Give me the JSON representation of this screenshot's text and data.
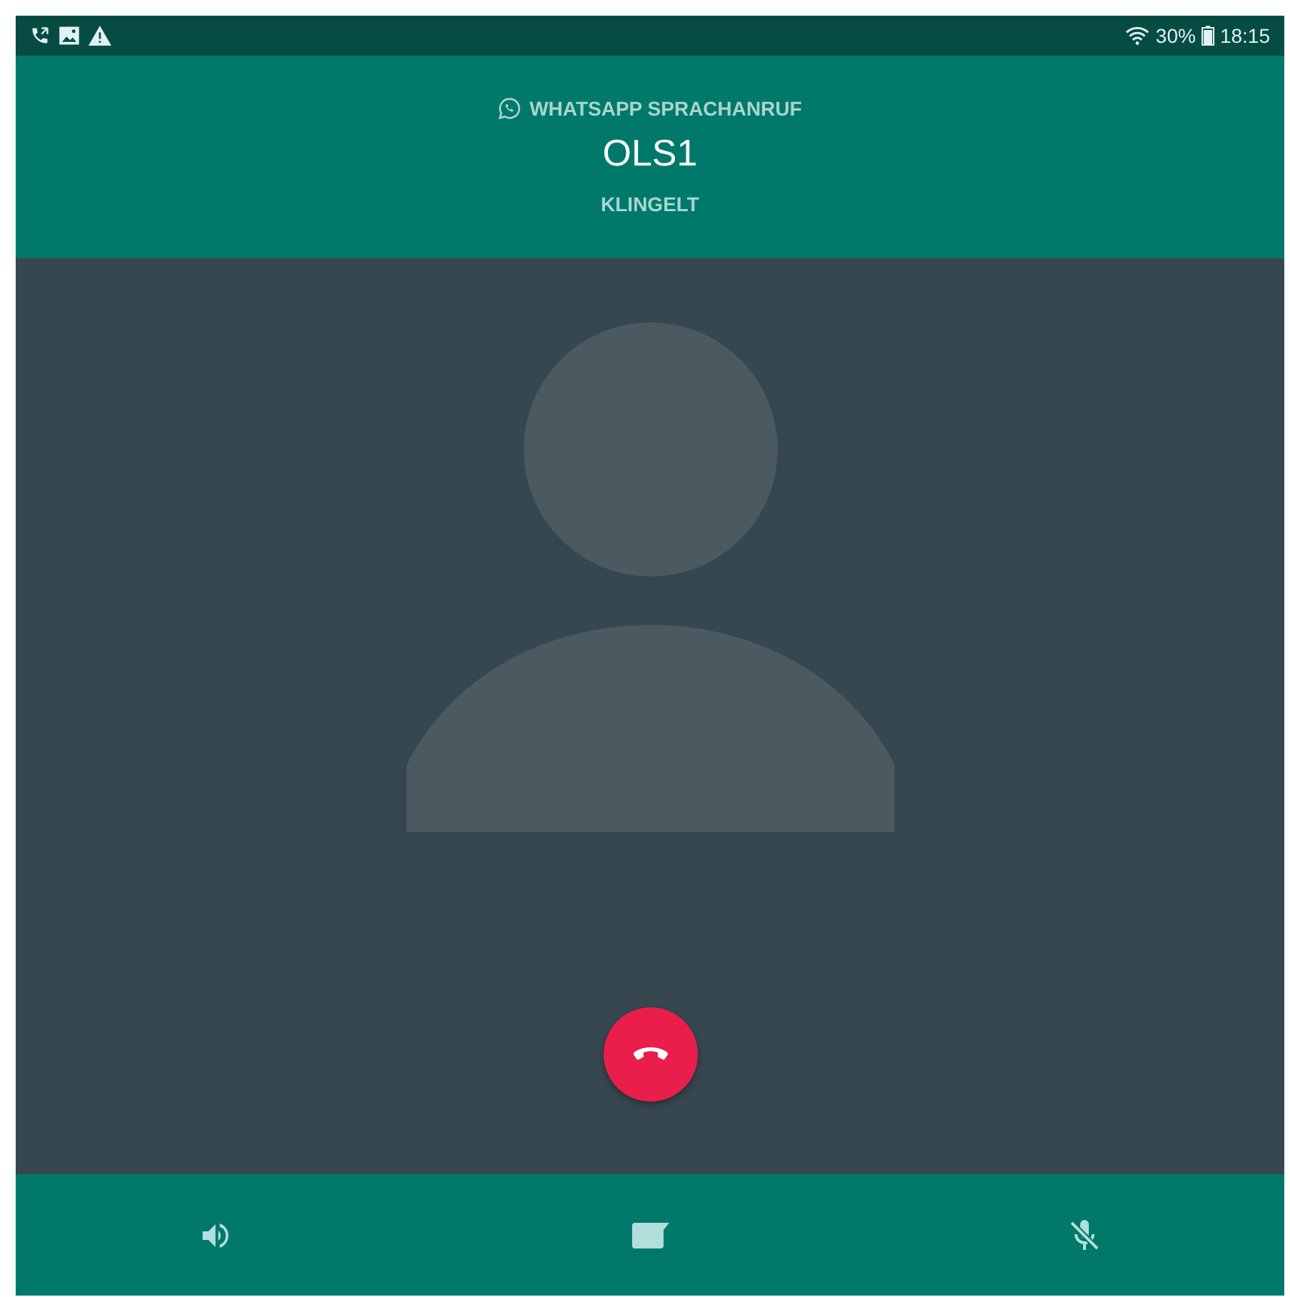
{
  "status_bar": {
    "battery": "30%",
    "time": "18:15"
  },
  "header": {
    "title": "WHATSAPP SPRACHANRUF",
    "contact": "OLS1",
    "call_state": "KLINGELT"
  },
  "controls": [
    {
      "kind": "speaker"
    },
    {
      "kind": "video"
    },
    {
      "kind": "mic-muted"
    }
  ]
}
